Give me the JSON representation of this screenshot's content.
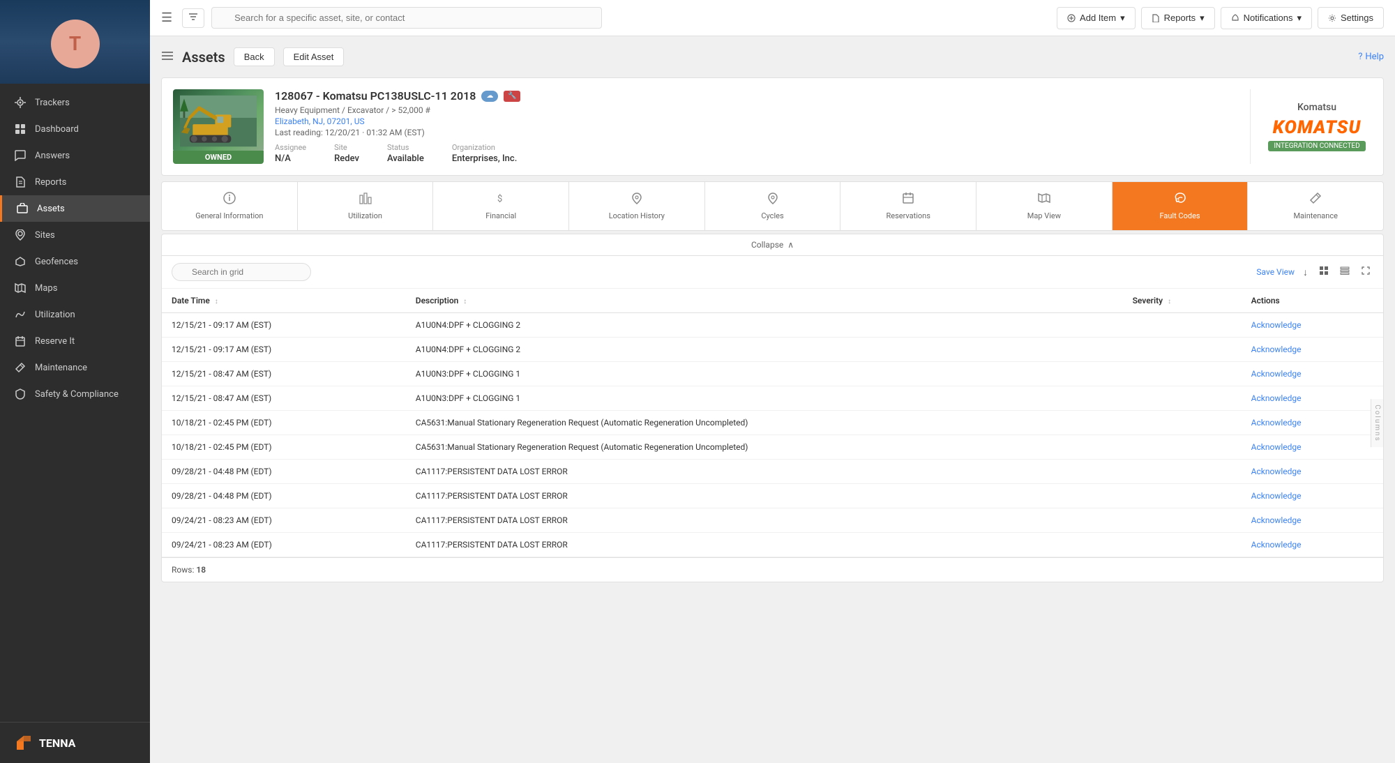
{
  "sidebar": {
    "avatar_letter": "T",
    "nav_items": [
      {
        "id": "trackers",
        "label": "Trackers",
        "icon": "tracker"
      },
      {
        "id": "dashboard",
        "label": "Dashboard",
        "icon": "dashboard"
      },
      {
        "id": "answers",
        "label": "Answers",
        "icon": "answers"
      },
      {
        "id": "reports",
        "label": "Reports",
        "icon": "reports"
      },
      {
        "id": "assets",
        "label": "Assets",
        "icon": "assets",
        "active": true
      },
      {
        "id": "sites",
        "label": "Sites",
        "icon": "sites"
      },
      {
        "id": "geofences",
        "label": "Geofences",
        "icon": "geofences"
      },
      {
        "id": "maps",
        "label": "Maps",
        "icon": "maps"
      },
      {
        "id": "utilization",
        "label": "Utilization",
        "icon": "utilization"
      },
      {
        "id": "reserve-it",
        "label": "Reserve It",
        "icon": "reserve"
      },
      {
        "id": "maintenance",
        "label": "Maintenance",
        "icon": "maintenance"
      },
      {
        "id": "safety",
        "label": "Safety & Compliance",
        "icon": "safety"
      }
    ],
    "logo_text": "TENNA"
  },
  "topbar": {
    "search_placeholder": "Search for a specific asset, site, or contact",
    "add_item_label": "Add Item",
    "reports_label": "Reports",
    "notifications_label": "Notifications",
    "settings_label": "Settings"
  },
  "page": {
    "title": "Assets",
    "back_label": "Back",
    "edit_label": "Edit Asset",
    "help_label": "Help"
  },
  "asset": {
    "id": "128067",
    "name": "Komatsu PC138USLC-11 2018",
    "subtitle": "Heavy Equipment / Excavator / > 52,000 #",
    "location": "Elizabeth, NJ, 07201, US",
    "last_reading": "Last reading: 12/20/21 · 01:32 AM (EST)",
    "assignee_label": "Assignee",
    "assignee_value": "N/A",
    "site_label": "Site",
    "site_value": "Redev",
    "status_label": "Status",
    "status_value": "Available",
    "org_label": "Organization",
    "org_value": "Enterprises, Inc.",
    "owned_badge": "OWNED",
    "brand_name": "Komatsu",
    "integration_badge": "INTEGRATION CONNECTED"
  },
  "tabs": [
    {
      "id": "general",
      "label": "General Information",
      "icon": "ℹ",
      "active": false
    },
    {
      "id": "utilization",
      "label": "Utilization",
      "icon": "▦",
      "active": false
    },
    {
      "id": "financial",
      "label": "Financial",
      "icon": "$",
      "active": false
    },
    {
      "id": "location-history",
      "label": "Location History",
      "icon": "📍",
      "active": false
    },
    {
      "id": "cycles",
      "label": "Cycles",
      "icon": "📍",
      "active": false
    },
    {
      "id": "reservations",
      "label": "Reservations",
      "icon": "📅",
      "active": false
    },
    {
      "id": "map-view",
      "label": "Map View",
      "icon": "🗺",
      "active": false
    },
    {
      "id": "fault-codes",
      "label": "Fault Codes",
      "icon": "☁",
      "active": true
    },
    {
      "id": "maintenance",
      "label": "Maintenance",
      "icon": "🔧",
      "active": false
    }
  ],
  "grid": {
    "collapse_label": "Collapse",
    "search_placeholder": "Search in grid",
    "save_view_label": "Save View",
    "rows_label": "Rows:",
    "rows_count": "18",
    "columns": [
      {
        "id": "datetime",
        "label": "Date Time",
        "sortable": true
      },
      {
        "id": "description",
        "label": "Description",
        "sortable": true
      },
      {
        "id": "severity",
        "label": "Severity",
        "sortable": true
      },
      {
        "id": "actions",
        "label": "Actions",
        "sortable": false
      }
    ],
    "rows": [
      {
        "datetime": "12/15/21 - 09:17 AM (EST)",
        "description": "A1U0N4:DPF + CLOGGING 2",
        "severity": "",
        "action": "Acknowledge"
      },
      {
        "datetime": "12/15/21 - 09:17 AM (EST)",
        "description": "A1U0N4:DPF + CLOGGING 2",
        "severity": "",
        "action": "Acknowledge"
      },
      {
        "datetime": "12/15/21 - 08:47 AM (EST)",
        "description": "A1U0N3:DPF + CLOGGING 1",
        "severity": "",
        "action": "Acknowledge"
      },
      {
        "datetime": "12/15/21 - 08:47 AM (EST)",
        "description": "A1U0N3:DPF + CLOGGING 1",
        "severity": "",
        "action": "Acknowledge"
      },
      {
        "datetime": "10/18/21 - 02:45 PM (EDT)",
        "description": "CA5631:Manual Stationary Regeneration Request (Automatic Regeneration Uncompleted)",
        "severity": "",
        "action": "Acknowledge"
      },
      {
        "datetime": "10/18/21 - 02:45 PM (EDT)",
        "description": "CA5631:Manual Stationary Regeneration Request (Automatic Regeneration Uncompleted)",
        "severity": "",
        "action": "Acknowledge"
      },
      {
        "datetime": "09/28/21 - 04:48 PM (EDT)",
        "description": "CA1117:PERSISTENT DATA LOST ERROR",
        "severity": "",
        "action": "Acknowledge"
      },
      {
        "datetime": "09/28/21 - 04:48 PM (EDT)",
        "description": "CA1117:PERSISTENT DATA LOST ERROR",
        "severity": "",
        "action": "Acknowledge"
      },
      {
        "datetime": "09/24/21 - 08:23 AM (EDT)",
        "description": "CA1117:PERSISTENT DATA LOST ERROR",
        "severity": "",
        "action": "Acknowledge"
      },
      {
        "datetime": "09/24/21 - 08:23 AM (EDT)",
        "description": "CA1117:PERSISTENT DATA LOST ERROR",
        "severity": "",
        "action": "Acknowledge"
      }
    ]
  },
  "colors": {
    "accent_orange": "#f47820",
    "link_blue": "#3b82f6",
    "active_green": "#4a8a4a",
    "komatsu_orange": "#ff6600"
  }
}
